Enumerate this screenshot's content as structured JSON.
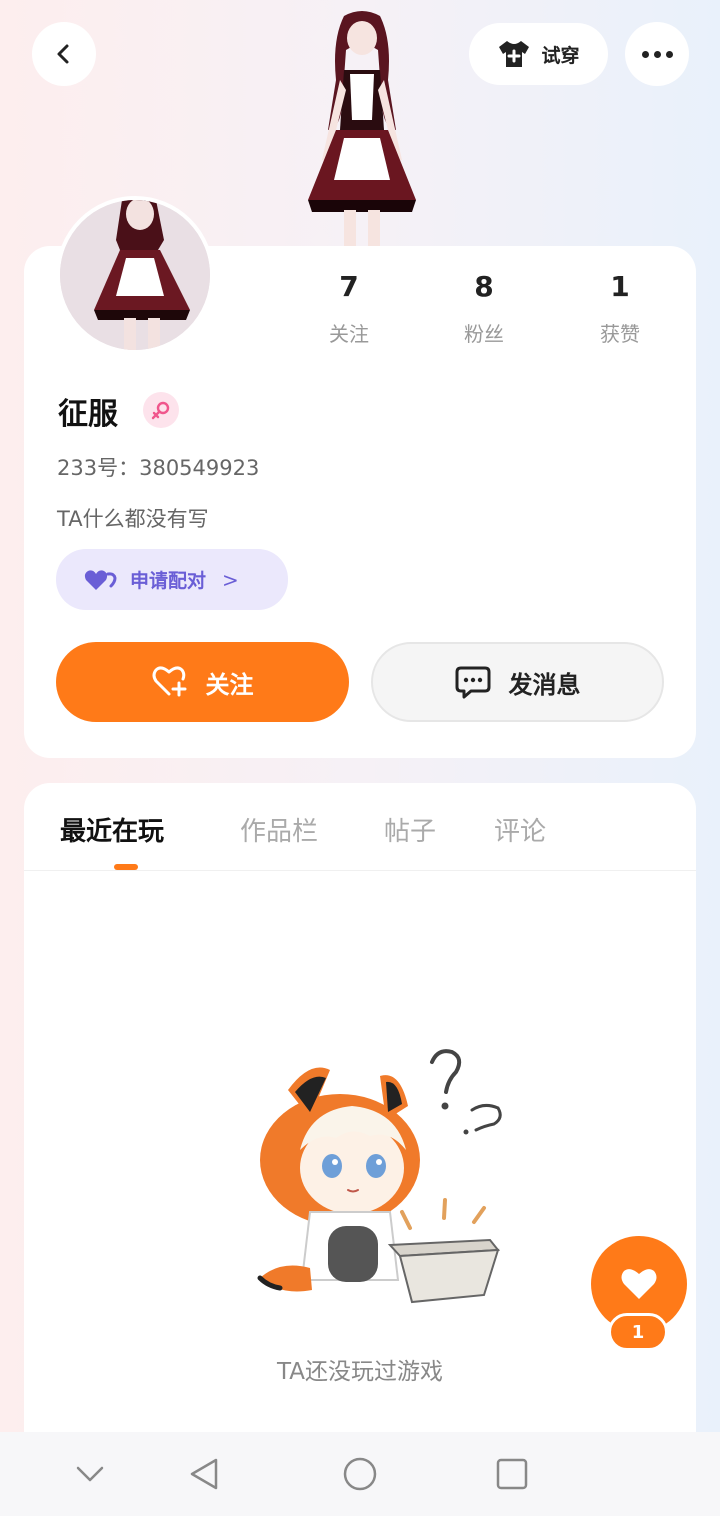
{
  "header": {
    "tryon_label": "试穿"
  },
  "profile": {
    "nickname": "征服",
    "uid_label": "233号：",
    "uid_value": "380549923",
    "bio": "TA什么都没有写",
    "pair_label": "申请配对",
    "pair_chevron": ">",
    "stats": [
      {
        "value": "7",
        "label": "关注"
      },
      {
        "value": "8",
        "label": "粉丝"
      },
      {
        "value": "1",
        "label": "获赞"
      }
    ],
    "follow_label": "关注",
    "message_label": "发消息"
  },
  "tabs": [
    {
      "label": "最近在玩",
      "active": true
    },
    {
      "label": "作品栏",
      "active": false
    },
    {
      "label": "帖子",
      "active": false
    },
    {
      "label": "评论",
      "active": false
    }
  ],
  "empty_state": {
    "text": "TA还没玩过游戏"
  },
  "like_fab": {
    "count": "1"
  },
  "colors": {
    "accent": "#ff7a18",
    "pair_bg": "#ebe8fc",
    "pair_text": "#6a5ed6",
    "gender_badge": "#fde3ec"
  }
}
